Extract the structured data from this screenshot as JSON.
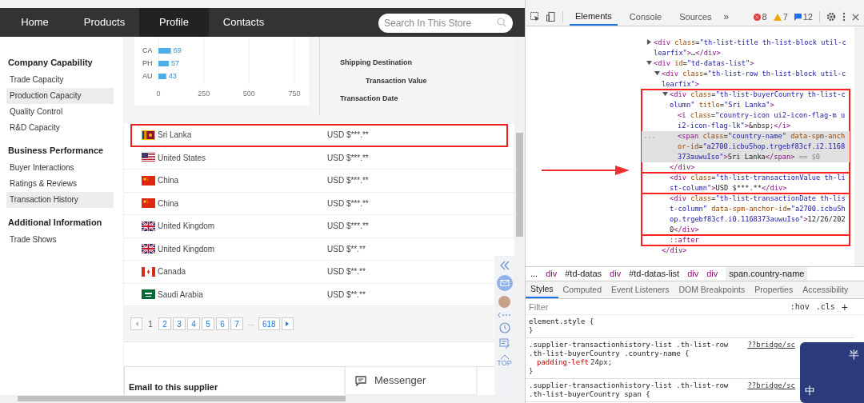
{
  "nav": {
    "items": [
      {
        "label": "Home",
        "selected": false
      },
      {
        "label": "Products",
        "selected": false
      },
      {
        "label": "Profile",
        "selected": true
      },
      {
        "label": "Contacts",
        "selected": false
      }
    ],
    "search": {
      "placeholder": "Search In This Store"
    }
  },
  "sidebar": {
    "groups": [
      {
        "title": "Company Capability",
        "items": [
          {
            "label": "Trade Capacity",
            "selected": false
          },
          {
            "label": "Production Capacity",
            "selected": true
          },
          {
            "label": "Quality Control",
            "selected": false
          },
          {
            "label": "R&D Capacity",
            "selected": false
          }
        ]
      },
      {
        "title": "Business Performance",
        "items": [
          {
            "label": "Buyer Interactions",
            "selected": false
          },
          {
            "label": "Ratings & Reviews",
            "selected": false
          },
          {
            "label": "Transaction History",
            "selected": true
          }
        ]
      },
      {
        "title": "Additional Information",
        "items": [
          {
            "label": "Trade Shows",
            "selected": false
          }
        ]
      }
    ]
  },
  "chart": {
    "chart_data": {
      "type": "bar",
      "orientation": "horizontal",
      "categories": [
        "CA",
        "PH",
        "AU"
      ],
      "values": [
        69,
        57,
        43
      ],
      "xlim": [
        0,
        750
      ],
      "xticks": [
        0,
        250,
        500,
        750
      ],
      "data_labels": true
    }
  },
  "table": {
    "headers": [
      "Shipping Destination",
      "Transaction Value",
      "Transaction Date"
    ],
    "rows": [
      {
        "kind": "lk",
        "country": "Sri Lanka",
        "value": "USD $***.**",
        "highlighted": true
      },
      {
        "kind": "us",
        "country": "United States",
        "value": "USD $***.**",
        "highlighted": false
      },
      {
        "kind": "cn",
        "country": "China",
        "value": "USD $***.**",
        "highlighted": false
      },
      {
        "kind": "cn",
        "country": "China",
        "value": "USD $***.**",
        "highlighted": false
      },
      {
        "kind": "gb",
        "country": "United Kingdom",
        "value": "USD $***.**",
        "highlighted": false
      },
      {
        "kind": "gb",
        "country": "United Kingdom",
        "value": "USD $**.**",
        "highlighted": false
      },
      {
        "kind": "ca",
        "country": "Canada",
        "value": "USD $**.**",
        "highlighted": false
      },
      {
        "kind": "sa",
        "country": "Saudi Arabia",
        "value": "USD $**.**",
        "highlighted": false
      }
    ]
  },
  "pagination": {
    "pages": [
      {
        "label": "1",
        "selected": true
      },
      {
        "label": "2",
        "selected": false
      },
      {
        "label": "3",
        "selected": false
      },
      {
        "label": "4",
        "selected": false
      },
      {
        "label": "5",
        "selected": false
      },
      {
        "label": "6",
        "selected": false
      },
      {
        "label": "7",
        "selected": false
      },
      {
        "label": "...",
        "kind": "gap"
      },
      {
        "label": "618",
        "selected": false
      }
    ]
  },
  "email_card": {
    "title": "Email to this supplier"
  },
  "messenger": {
    "label": "Messenger"
  },
  "side_toolbar": {
    "top_label": "TOP"
  },
  "devtools": {
    "tabs": [
      {
        "label": "Elements",
        "selected": true
      },
      {
        "label": "Console",
        "selected": false
      },
      {
        "label": "Sources",
        "selected": false
      }
    ],
    "more": "»",
    "errors": "8",
    "warnings": "7",
    "messages": "12",
    "dom": [
      {
        "text": "<div class=\"th-list-title th-list-block util-clearfix\">…</div>",
        "expanded": false,
        "selected": false,
        "highlighted": false
      },
      {
        "text": "<div id=\"td-datas-list\">",
        "expanded": true,
        "selected": false,
        "highlighted": false,
        "children": [
          {
            "text": "<div class=\"th-list-row th-list-block util-clearfix\">",
            "expanded": true,
            "selected": false,
            "highlighted": false,
            "close": "</div>",
            "children": [
              {
                "text": "<div class=\"th-list-buyerCountry th-list-column\" title=\"Sri Lanka\">",
                "expanded": true,
                "selected": false,
                "highlighted": true,
                "close": "</div>",
                "children": [
                  {
                    "text": "<i class=\"country-icon ui2-icon-flag-m ui2-icon-flag-lk\">&nbsp;</i>",
                    "selected": false,
                    "highlighted": false
                  },
                  {
                    "text": "<span class=\"country-name\" data-spm-anchor-id=\"a2700.icbuShop.trgebf83cf.i2.1168373auwuIso\">Sri Lanka</span>",
                    "suffix": " == $0",
                    "gutter": "...",
                    "selected": true,
                    "highlighted": false
                  }
                ]
              },
              {
                "text": "<div class=\"th-list-transactionValue th-list-column\">USD $***.**</div>",
                "selected": false,
                "highlighted": true
              },
              {
                "text": "<div class=\"th-list-transactionDate th-list-column\" data-spm-anchor-id=\"a2700.icbuShop.trgebf83cf.i0.1168373auwuIso\">12/26/2020</div>",
                "selected": false,
                "highlighted": true
              },
              {
                "text": "::after",
                "selected": false,
                "highlighted": true
              }
            ]
          }
        ]
      }
    ],
    "breadcrumbs": [
      "...",
      "div",
      "#td-datas",
      "div",
      "#td-datas-list",
      "div",
      "div",
      "span.country-name"
    ],
    "style_tabs": [
      {
        "label": "Styles",
        "selected": true
      },
      {
        "label": "Computed",
        "selected": false
      },
      {
        "label": "Event Listeners",
        "selected": false
      },
      {
        "label": "DOM Breakpoints",
        "selected": false
      },
      {
        "label": "Properties",
        "selected": false
      },
      {
        "label": "Accessibility",
        "selected": false
      }
    ],
    "filter": {
      "placeholder": "Filter"
    },
    "hov": ":hov",
    "cls": ".cls",
    "add": "+",
    "rules": [
      {
        "selector": "element.style {",
        "close": "}"
      },
      {
        "selector": ".supplier-transactionhistory-list .th-list-row .th-list-buyerCountry .country-name {",
        "source": "??bridge/sc",
        "declarations": [
          {
            "prop": "padding-left",
            "value": "24px;"
          }
        ],
        "close": "}"
      },
      {
        "selector": ".supplier-transactionhistory-list .th-list-row .th-list-buyerCountry span {",
        "source": "??bridge/sc"
      }
    ]
  },
  "ime": {
    "chars": [
      "半",
      "中"
    ]
  }
}
